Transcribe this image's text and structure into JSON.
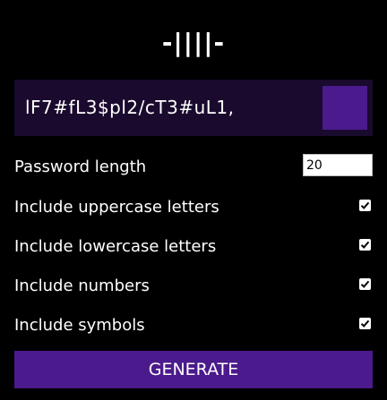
{
  "app": {
    "logo_text": "-||||-"
  },
  "result": {
    "password": "lF7#fL3$pl2/cT3#uL1,"
  },
  "colors": {
    "background": "#000000",
    "result_bg": "#1a0a2e",
    "accent": "#4b1a8c"
  },
  "settings": {
    "length": {
      "label": "Password length",
      "value": "20"
    },
    "uppercase": {
      "label": "Include uppercase letters",
      "checked": true
    },
    "lowercase": {
      "label": "Include lowercase letters",
      "checked": true
    },
    "numbers": {
      "label": "Include numbers",
      "checked": true
    },
    "symbols": {
      "label": "Include symbols",
      "checked": true
    }
  },
  "actions": {
    "generate_label": "GENERATE",
    "copy_icon": "clipboard-icon"
  }
}
